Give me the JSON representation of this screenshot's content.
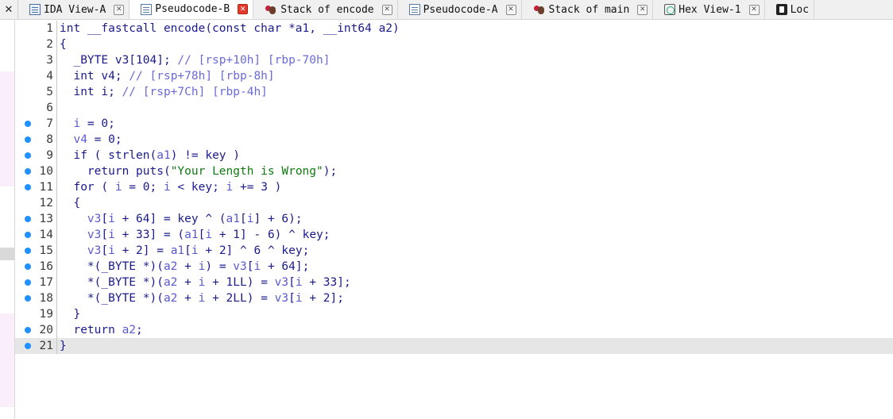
{
  "tabs": [
    {
      "label": "IDA View-A",
      "icon": "ida-view-icon",
      "active": false
    },
    {
      "label": "Pseudocode-B",
      "icon": "pseudocode-icon",
      "active": true
    },
    {
      "label": "Stack of encode",
      "icon": "stack-icon",
      "active": false
    },
    {
      "label": "Pseudocode-A",
      "icon": "pseudocode-icon",
      "active": false
    },
    {
      "label": "Stack of main",
      "icon": "stack-icon",
      "active": false
    },
    {
      "label": "Hex View-1",
      "icon": "hex-view-icon",
      "active": false
    },
    {
      "label": "Loc",
      "icon": "locals-icon",
      "active": false
    }
  ],
  "close_left_label": "✕",
  "colors": {
    "breakpoint_dot": "#1e90ff",
    "string": "#0f7a0f",
    "comment": "#6a6ad8",
    "keyword": "#1a1a8c",
    "variable": "#5a5ad0",
    "current_line": "#e6e6e6",
    "active_tab_close": "#e33a2a"
  },
  "code_lines": [
    {
      "num": "1",
      "dot": false,
      "tokens": [
        [
          "kw",
          "int __fastcall encode(const char *a1, __int64 a2)"
        ]
      ]
    },
    {
      "num": "2",
      "dot": false,
      "tokens": [
        [
          "kw",
          "{"
        ]
      ]
    },
    {
      "num": "3",
      "dot": false,
      "tokens": [
        [
          "kw",
          "  _BYTE v3[104]; "
        ],
        [
          "cm",
          "// [rsp+10h] [rbp-70h]"
        ]
      ]
    },
    {
      "num": "4",
      "dot": false,
      "tokens": [
        [
          "kw",
          "  int v4; "
        ],
        [
          "cm",
          "// [rsp+78h] [rbp-8h]"
        ]
      ]
    },
    {
      "num": "5",
      "dot": false,
      "tokens": [
        [
          "kw",
          "  int i; "
        ],
        [
          "cm",
          "// [rsp+7Ch] [rbp-4h]"
        ]
      ]
    },
    {
      "num": "6",
      "dot": false,
      "tokens": [
        [
          "kw",
          ""
        ]
      ]
    },
    {
      "num": "7",
      "dot": true,
      "tokens": [
        [
          "var",
          "  i"
        ],
        [
          "kw",
          " = 0;"
        ]
      ]
    },
    {
      "num": "8",
      "dot": true,
      "tokens": [
        [
          "var",
          "  v4"
        ],
        [
          "kw",
          " = 0;"
        ]
      ]
    },
    {
      "num": "9",
      "dot": true,
      "tokens": [
        [
          "kw",
          "  if ( strlen("
        ],
        [
          "var",
          "a1"
        ],
        [
          "kw",
          ") != key )"
        ]
      ]
    },
    {
      "num": "10",
      "dot": true,
      "tokens": [
        [
          "kw",
          "    return puts("
        ],
        [
          "str",
          "\"Your Length is Wrong\""
        ],
        [
          "kw",
          ");"
        ]
      ]
    },
    {
      "num": "11",
      "dot": true,
      "tokens": [
        [
          "kw",
          "  for ( "
        ],
        [
          "var",
          "i"
        ],
        [
          "kw",
          " = 0; "
        ],
        [
          "var",
          "i"
        ],
        [
          "kw",
          " < key; "
        ],
        [
          "var",
          "i"
        ],
        [
          "kw",
          " += 3 )"
        ]
      ]
    },
    {
      "num": "12",
      "dot": false,
      "tokens": [
        [
          "kw",
          "  {"
        ]
      ]
    },
    {
      "num": "13",
      "dot": true,
      "tokens": [
        [
          "var",
          "    v3"
        ],
        [
          "kw",
          "["
        ],
        [
          "var",
          "i"
        ],
        [
          "kw",
          " + 64] = key ^ ("
        ],
        [
          "var",
          "a1"
        ],
        [
          "kw",
          "["
        ],
        [
          "var",
          "i"
        ],
        [
          "kw",
          "] + 6);"
        ]
      ]
    },
    {
      "num": "14",
      "dot": true,
      "tokens": [
        [
          "var",
          "    v3"
        ],
        [
          "kw",
          "["
        ],
        [
          "var",
          "i"
        ],
        [
          "kw",
          " + 33] = ("
        ],
        [
          "var",
          "a1"
        ],
        [
          "kw",
          "["
        ],
        [
          "var",
          "i"
        ],
        [
          "kw",
          " + 1] - 6) ^ key;"
        ]
      ]
    },
    {
      "num": "15",
      "dot": true,
      "tokens": [
        [
          "var",
          "    v3"
        ],
        [
          "kw",
          "["
        ],
        [
          "var",
          "i"
        ],
        [
          "kw",
          " + 2] = "
        ],
        [
          "var",
          "a1"
        ],
        [
          "kw",
          "["
        ],
        [
          "var",
          "i"
        ],
        [
          "kw",
          " + 2] ^ 6 ^ key;"
        ]
      ]
    },
    {
      "num": "16",
      "dot": true,
      "tokens": [
        [
          "kw",
          "    *(_BYTE *)("
        ],
        [
          "var",
          "a2"
        ],
        [
          "kw",
          " + "
        ],
        [
          "var",
          "i"
        ],
        [
          "kw",
          ") = "
        ],
        [
          "var",
          "v3"
        ],
        [
          "kw",
          "["
        ],
        [
          "var",
          "i"
        ],
        [
          "kw",
          " + 64];"
        ]
      ]
    },
    {
      "num": "17",
      "dot": true,
      "tokens": [
        [
          "kw",
          "    *(_BYTE *)("
        ],
        [
          "var",
          "a2"
        ],
        [
          "kw",
          " + "
        ],
        [
          "var",
          "i"
        ],
        [
          "kw",
          " + 1LL) = "
        ],
        [
          "var",
          "v3"
        ],
        [
          "kw",
          "["
        ],
        [
          "var",
          "i"
        ],
        [
          "kw",
          " + 33];"
        ]
      ]
    },
    {
      "num": "18",
      "dot": true,
      "tokens": [
        [
          "kw",
          "    *(_BYTE *)("
        ],
        [
          "var",
          "a2"
        ],
        [
          "kw",
          " + "
        ],
        [
          "var",
          "i"
        ],
        [
          "kw",
          " + 2LL) = "
        ],
        [
          "var",
          "v3"
        ],
        [
          "kw",
          "["
        ],
        [
          "var",
          "i"
        ],
        [
          "kw",
          " + 2];"
        ]
      ]
    },
    {
      "num": "19",
      "dot": false,
      "tokens": [
        [
          "kw",
          "  }"
        ]
      ]
    },
    {
      "num": "20",
      "dot": true,
      "tokens": [
        [
          "kw",
          "  return "
        ],
        [
          "var",
          "a2"
        ],
        [
          "kw",
          ";"
        ]
      ]
    },
    {
      "num": "21",
      "dot": true,
      "current": true,
      "tokens": [
        [
          "kw",
          "}"
        ]
      ]
    }
  ]
}
